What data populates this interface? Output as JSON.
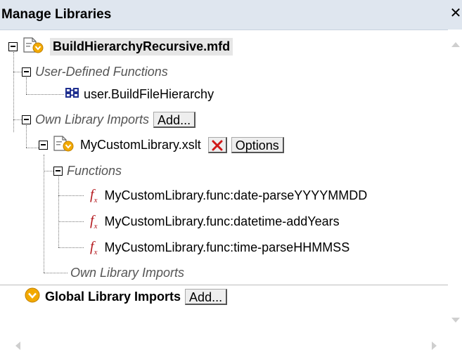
{
  "panel": {
    "title": "Manage Libraries",
    "close_glyph": "✕"
  },
  "tree": {
    "root": {
      "label": "BuildHierarchyRecursive.mfd",
      "icon": "mapping-file-icon"
    },
    "udf_group": {
      "label": "User-Defined Functions"
    },
    "udf_item": {
      "label": "user.BuildFileHierarchy",
      "icon": "user-function-icon"
    },
    "own_imports": {
      "label": "Own Library Imports",
      "add_label": "Add..."
    },
    "library": {
      "label": "MyCustomLibrary.xslt",
      "icon": "xslt-file-icon",
      "delete_icon": "delete-x-icon",
      "options_label": "Options"
    },
    "functions_group": {
      "label": "Functions"
    },
    "functions": [
      {
        "label": "MyCustomLibrary.func:date-parseYYYYMMDD"
      },
      {
        "label": "MyCustomLibrary.func:datetime-addYears"
      },
      {
        "label": "MyCustomLibrary.func:time-parseHHMMSS"
      }
    ],
    "own_imports_nested": {
      "label": "Own Library Imports"
    },
    "global_imports": {
      "label": "Global Library Imports",
      "add_label": "Add...",
      "icon": "global-library-icon"
    }
  },
  "colors": {
    "titlebar": "#dfe6ef",
    "function_icon": "#b3161b",
    "delete_icon": "#d01818",
    "global_icon": "#f2a900"
  }
}
